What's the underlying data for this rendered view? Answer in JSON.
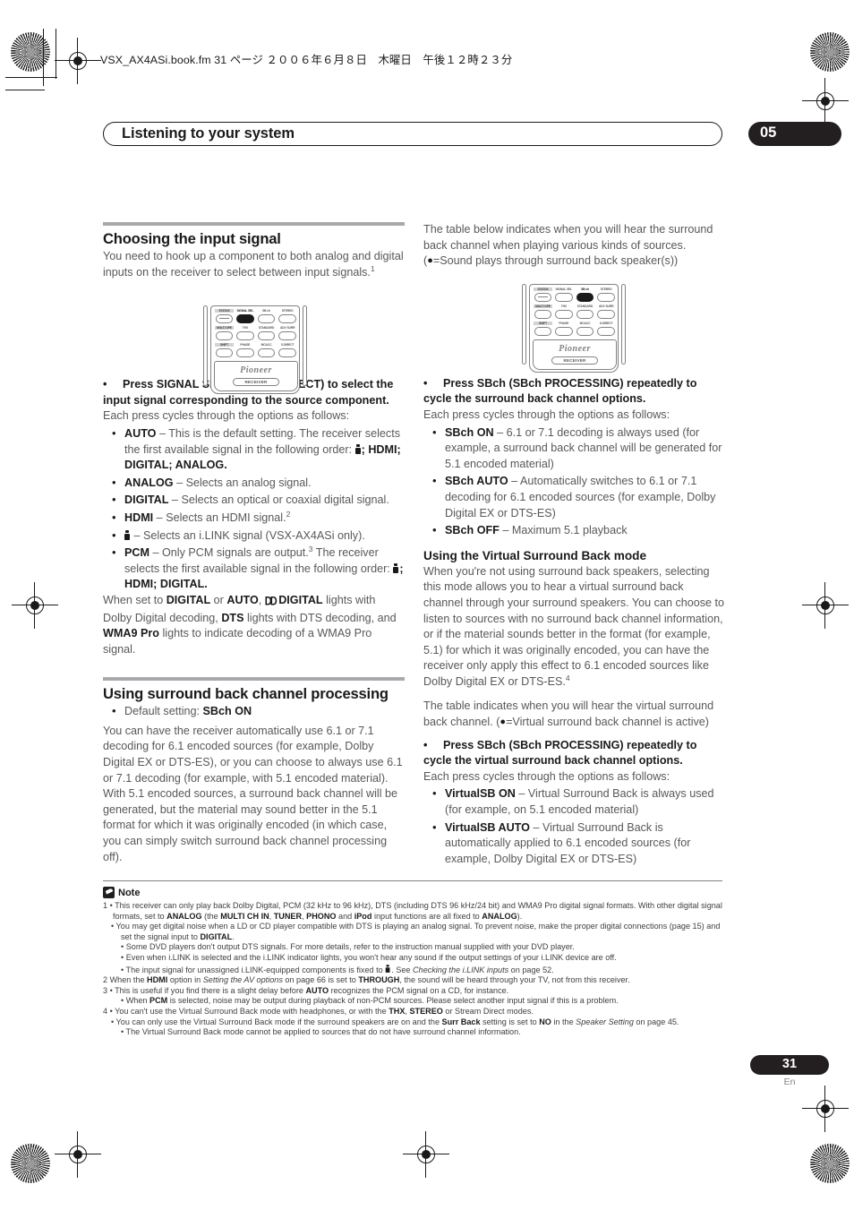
{
  "file_header": "VSX_AX4ASi.book.fm 31 ページ ２００６年６月８日　木曜日　午後１２時２３分",
  "chapter": {
    "title": "Listening to your system",
    "number": "05"
  },
  "left_column": {
    "section1": {
      "heading": "Choosing the input signal",
      "intro_a": "You need to hook up a component to both analog and digital inputs on the receiver to select between input signals.",
      "intro_sup": "1",
      "lead_bullet": "Press SIGNAL SEL (SIGNAL SELECT) to select the input signal corresponding to the source component.",
      "cycle_text": "Each press cycles through the options as follows:",
      "options": [
        {
          "term": "AUTO",
          "desc": " – This is the default setting. The receiver selects the first available signal in the following order: "
        },
        {
          "term": "ANALOG",
          "desc": " – Selects an analog signal."
        },
        {
          "term": "DIGITAL",
          "desc": " – Selects an optical or coaxial digital signal."
        },
        {
          "term": "HDMI",
          "desc": " – Selects an HDMI signal.",
          "sup": "2"
        },
        {
          "term": "",
          "desc": " – Selects an i.LINK signal (VSX-AX4ASi only)."
        },
        {
          "term": "PCM",
          "desc": " – Only PCM signals are output.",
          "sup": "3",
          "desc2": " The receiver selects the first available signal in the following order: "
        }
      ],
      "auto_order_tail": "; HDMI; DIGITAL; ANALOG.",
      "pcm_order_tail": "; HDMI; DIGITAL.",
      "closing_1": "When set to ",
      "closing_digital": "DIGITAL",
      "closing_2": " or ",
      "closing_auto": "AUTO",
      "closing_3": ", ",
      "closing_dd": "DIGITAL",
      "closing_4": " lights with Dolby Digital decoding, ",
      "closing_dts": "DTS",
      "closing_5": " lights with DTS decoding, and ",
      "closing_wma": "WMA9 Pro",
      "closing_6": " lights to indicate decoding of a WMA9 Pro signal."
    },
    "section2": {
      "heading": "Using surround back channel processing",
      "default_prefix": "Default setting: ",
      "default_value": "SBch ON",
      "body": "You can have the receiver automatically use 6.1 or 7.1 decoding for 6.1 encoded sources (for example, Dolby Digital EX or DTS-ES), or you can choose to always use 6.1 or 7.1 decoding (for example, with 5.1 encoded material). With 5.1 encoded sources, a surround back channel will be generated, but the material may sound better in the 5.1 format for which it was originally encoded (in which case, you can simply switch surround back channel processing off)."
    }
  },
  "right_column": {
    "table_intro_1": "The table below indicates when you will hear the surround back channel when playing various kinds of sources. (",
    "table_intro_2": "=Sound plays through surround back speaker(s))",
    "lead_bullet": "Press SBch (SBch PROCESSING) repeatedly to cycle the surround back channel options.",
    "cycle_text": "Each press cycles through the options as follows:",
    "options": [
      {
        "term": "SBch ON",
        "desc": " – 6.1 or 7.1 decoding is always used (for example, a surround back channel will be generated for 5.1 encoded material)"
      },
      {
        "term": "SBch AUTO",
        "desc": " – Automatically switches to 6.1 or 7.1 decoding for 6.1 encoded sources (for example, Dolby Digital EX or DTS-ES)"
      },
      {
        "term": "SBch OFF",
        "desc": " – Maximum 5.1 playback"
      }
    ],
    "section3": {
      "heading": "Using the Virtual Surround Back mode",
      "body": "When you're not using surround back speakers, selecting this mode allows you to hear a virtual surround back channel through your surround speakers. You can choose to listen to sources with no surround back channel information, or if the material sounds better in the format (for example, 5.1) for which it was originally encoded, you can have the receiver only apply this effect to 6.1 encoded sources like Dolby Digital EX or DTS-ES.",
      "body_sup": "4",
      "table_intro_1": "The table indicates when you will hear the virtual surround back channel. (",
      "table_intro_2": "=Virtual surround back channel is active)",
      "lead_bullet": "Press SBch (SBch PROCESSING) repeatedly to cycle the virtual surround back channel options.",
      "cycle_text": "Each press cycles through the options as follows:",
      "options": [
        {
          "term": "VirtualSB ON",
          "desc": " – Virtual Surround Back is always used (for example, on 5.1 encoded material)"
        },
        {
          "term": "VirtualSB AUTO",
          "desc": " – Virtual Surround Back is automatically applied to 6.1 encoded sources (for example, Dolby Digital EX or DTS-ES)"
        }
      ]
    }
  },
  "remote_left": {
    "highlight": "SIGNAL SEL",
    "rows": [
      [
        "STATUS",
        "SIGNAL SEL",
        "SB ch",
        "STEREO"
      ],
      [
        "MULTI OPE",
        "THX",
        "STANDARD",
        "ADV SURR"
      ],
      [
        "SHIFT",
        "PHASE",
        "MCACC",
        "S.DIRECT"
      ]
    ],
    "brand": "Pioneer",
    "receiver_label": "RECEIVER"
  },
  "remote_right": {
    "highlight": "SB ch",
    "rows": [
      [
        "STATUS",
        "SIGNAL SEL",
        "SB ch",
        "STEREO"
      ],
      [
        "MULTI OPE",
        "THX",
        "STANDARD",
        "ADV SURR"
      ],
      [
        "SHIFT",
        "PHASE",
        "MCACC",
        "S.DIRECT"
      ]
    ],
    "brand": "Pioneer",
    "receiver_label": "RECEIVER"
  },
  "notes": {
    "label": "Note",
    "items": [
      "1 • This receiver can only play back Dolby Digital, PCM (32 kHz to 96 kHz), DTS (including DTS 96 kHz/24 bit) and WMA9 Pro digital signal formats. With other digital signal formats, set to ANALOG (the MULTI CH IN, TUNER, PHONO and iPod input functions are all fixed to ANALOG).",
      "• You may get digital noise when a LD or CD player compatible with DTS is playing an analog signal. To prevent noise, make the proper digital connections (page 15) and set the signal input to DIGITAL.",
      "• Some DVD players don't output DTS signals. For more details, refer to the instruction manual supplied with your DVD player.",
      "• Even when i.LINK is selected and the i.LINK indicator lights, you won't hear any sound if the output settings of your i.LINK device are off.",
      "• The input signal for unassigned i.LINK-equipped components is fixed to . See Checking the i.LINK inputs on page 52.",
      "2 When the HDMI option in Setting the AV options on page 66 is set to THROUGH, the sound will be heard through your TV, not from this receiver.",
      "3 • This is useful if you find there is a slight delay before AUTO recognizes the PCM signal on a CD, for instance.",
      "• When PCM is selected, noise may be output during playback of non-PCM sources. Please select another input signal if this is a problem.",
      "4 • You can't use the Virtual Surround Back mode with headphones, or with the THX, STEREO or Stream Direct modes.",
      "• You can only use the Virtual Surround Back mode if the surround speakers are on and the Surr Back setting is set to NO in the Speaker Setting on page 45.",
      "• The Virtual Surround Back mode cannot be applied to sources that do not have surround channel information."
    ]
  },
  "footer": {
    "page_number": "31",
    "language": "En"
  }
}
